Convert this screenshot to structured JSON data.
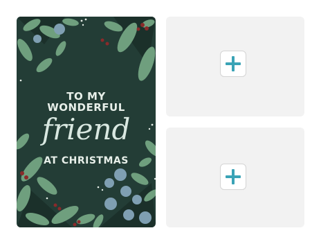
{
  "card": {
    "line1": "TO MY",
    "line2": "WONDERFUL",
    "line3": "friend",
    "line4": "AT CHRISTMAS"
  },
  "slots": [
    {
      "icon": "plus-icon"
    },
    {
      "icon": "plus-icon"
    }
  ],
  "colors": {
    "card_bg": "#233d36",
    "leaf_green": "#6f9f7e",
    "leaf_blue": "#7f9fb2",
    "berry_red": "#8a2a2a",
    "plus_accent": "#3aa3b6",
    "slot_bg": "#f2f2f2"
  }
}
